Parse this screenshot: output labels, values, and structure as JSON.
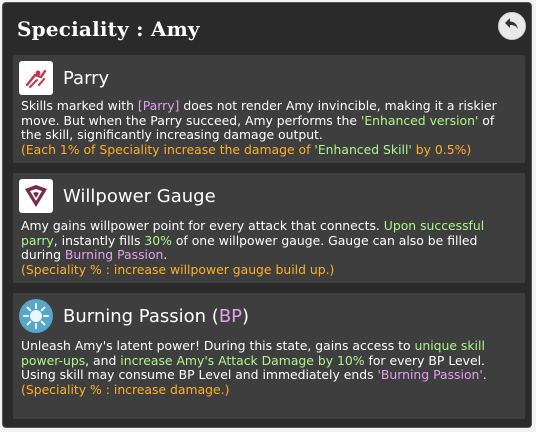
{
  "header": {
    "title": "Speciality : Amy",
    "back_icon": "back-arrow-icon"
  },
  "cards": [
    {
      "icon": "parry-icon",
      "title": "Parry",
      "line1_a": "Skills marked with ",
      "line1_b": "[Parry]",
      "line1_c": " does not render Amy invincible, making it a riskier move. But when the Parry succeed, Amy performs the ",
      "line1_d": "'Enhanced version'",
      "line1_e": " of the skill, significantly increasing damage output.",
      "note_a": "(Each 1% of Speciality increase the damage of ",
      "note_b": "'Enhanced Skill'",
      "note_c": " by 0.5%)"
    },
    {
      "icon": "willpower-gauge-icon",
      "title": "Willpower Gauge",
      "t_a": "Amy gains willpower point for every attack that connects. ",
      "t_b": "Upon successful parry",
      "t_c": ", instantly fills ",
      "t_d": "30%",
      "t_e": " of one willpower gauge. Gauge can also be filled during ",
      "t_f": "Burning Passion",
      "t_g": ".",
      "note": "(Speciality % : increase willpower gauge build up.)"
    },
    {
      "icon": "burning-passion-icon",
      "title_a": "Burning Passion (",
      "title_b": "BP",
      "title_c": ")",
      "t_a": "Unleash Amy's latent power! During this state, gains access to ",
      "t_b": "unique skill power-ups",
      "t_c": ", and ",
      "t_d": "increase Amy's Attack Damage by 10%",
      "t_e": " for every BP Level. Using skill may consume BP Level and immediately ends ",
      "t_f": "'Burning Passion'",
      "t_g": ".",
      "note": "(Speciality % : increase damage.)"
    }
  ],
  "colors": {
    "purple": "#e39ff0",
    "green": "#aef58c",
    "orange": "#ffae2b",
    "panel": "#2a2a2a",
    "card": "#3e3e3e"
  }
}
